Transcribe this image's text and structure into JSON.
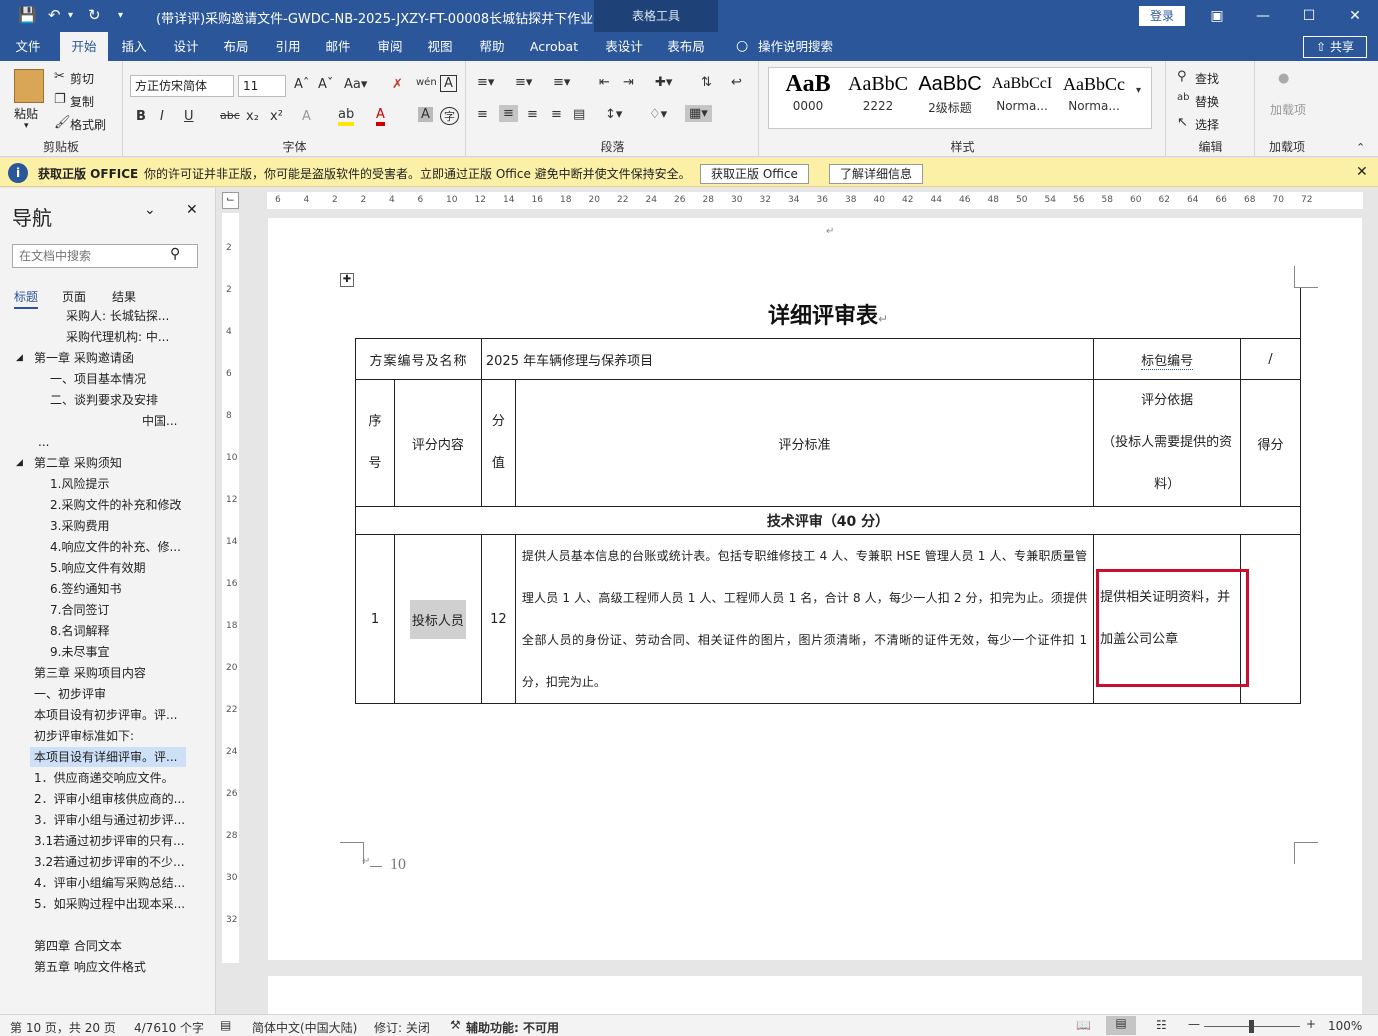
{
  "titlebar": {
    "title": "(带详评)采购邀请文件-GWDC-NB-2025-JXZY-FT-00008长城钻探井下作业...",
    "table_tools": "表格工具",
    "login": "登录"
  },
  "menu": {
    "tabs": [
      "文件",
      "开始",
      "插入",
      "设计",
      "布局",
      "引用",
      "邮件",
      "审阅",
      "视图",
      "帮助",
      "Acrobat",
      "表设计",
      "表布局"
    ],
    "search": "操作说明搜索",
    "share": "共享"
  },
  "ribbon": {
    "clipboard": {
      "label": "剪贴板",
      "paste": "粘贴",
      "cut": "剪切",
      "copy": "复制",
      "format_painter": "格式刷"
    },
    "font": {
      "label": "字体",
      "font_name": "方正仿宋简体",
      "font_size": "11"
    },
    "paragraph": {
      "label": "段落"
    },
    "styles": {
      "label": "样式",
      "items": [
        {
          "preview": "AaB",
          "name": "0000"
        },
        {
          "preview": "AaBbC",
          "name": "2222"
        },
        {
          "preview": "AaBbC",
          "name": "2级标题"
        },
        {
          "preview": "AaBbCcI",
          "name": "Norma..."
        },
        {
          "preview": "AaBbCc",
          "name": "Norma..."
        }
      ]
    },
    "editing": {
      "label": "编辑",
      "find": "查找",
      "replace": "替换",
      "select": "选择"
    },
    "addins": {
      "label": "加载项",
      "load": "加载项"
    }
  },
  "license": {
    "title": "获取正版 OFFICE",
    "message": "你的许可证并非正版，你可能是盗版软件的受害者。立即通过正版 Office 避免中断并使文件保持安全。",
    "btn_get": "获取正版 Office",
    "btn_learn": "了解详细信息"
  },
  "nav": {
    "title": "导航",
    "search_placeholder": "在文档中搜索",
    "tabs": [
      "标题",
      "页面",
      "结果"
    ],
    "items": [
      {
        "text": "采购人: 长城钻探...",
        "indent": 66,
        "selected": false,
        "arrow": ""
      },
      {
        "text": "采购代理机构: 中...",
        "indent": 66,
        "selected": false,
        "arrow": ""
      },
      {
        "text": "第一章 采购邀请函",
        "indent": 34,
        "selected": false,
        "arrow": "◢"
      },
      {
        "text": "一、项目基本情况",
        "indent": 50,
        "selected": false,
        "arrow": ""
      },
      {
        "text": "二、谈判要求及安排",
        "indent": 50,
        "selected": false,
        "arrow": ""
      },
      {
        "text": "中国...",
        "indent": 142,
        "selected": false,
        "arrow": ""
      },
      {
        "text": "...",
        "indent": 38,
        "selected": false,
        "arrow": ""
      },
      {
        "text": "第二章 采购须知",
        "indent": 34,
        "selected": false,
        "arrow": "◢"
      },
      {
        "text": "1.风险提示",
        "indent": 50,
        "selected": false,
        "arrow": ""
      },
      {
        "text": "2.采购文件的补充和修改",
        "indent": 50,
        "selected": false,
        "arrow": ""
      },
      {
        "text": "3.采购费用",
        "indent": 50,
        "selected": false,
        "arrow": ""
      },
      {
        "text": "4.响应文件的补充、修...",
        "indent": 50,
        "selected": false,
        "arrow": ""
      },
      {
        "text": "5.响应文件有效期",
        "indent": 50,
        "selected": false,
        "arrow": ""
      },
      {
        "text": "6.签约通知书",
        "indent": 50,
        "selected": false,
        "arrow": ""
      },
      {
        "text": "7.合同签订",
        "indent": 50,
        "selected": false,
        "arrow": ""
      },
      {
        "text": "8.名词解释",
        "indent": 50,
        "selected": false,
        "arrow": ""
      },
      {
        "text": "9.未尽事宜",
        "indent": 50,
        "selected": false,
        "arrow": ""
      },
      {
        "text": "第三章 采购项目内容",
        "indent": 34,
        "selected": false,
        "arrow": ""
      },
      {
        "text": "一、初步评审",
        "indent": 34,
        "selected": false,
        "arrow": ""
      },
      {
        "text": "本项目设有初步评审。评...",
        "indent": 34,
        "selected": false,
        "arrow": ""
      },
      {
        "text": "初步评审标准如下:",
        "indent": 34,
        "selected": false,
        "arrow": ""
      },
      {
        "text": "本项目设有详细评审。评...",
        "indent": 34,
        "selected": true,
        "arrow": ""
      },
      {
        "text": "1．供应商递交响应文件。",
        "indent": 34,
        "selected": false,
        "arrow": ""
      },
      {
        "text": "2．评审小组审核供应商的...",
        "indent": 34,
        "selected": false,
        "arrow": ""
      },
      {
        "text": "3．评审小组与通过初步评...",
        "indent": 34,
        "selected": false,
        "arrow": ""
      },
      {
        "text": "3.1若通过初步评审的只有...",
        "indent": 34,
        "selected": false,
        "arrow": ""
      },
      {
        "text": "3.2若通过初步评审的不少...",
        "indent": 34,
        "selected": false,
        "arrow": ""
      },
      {
        "text": "4．评审小组编写采购总结...",
        "indent": 34,
        "selected": false,
        "arrow": ""
      },
      {
        "text": "5．如采购过程中出现本采...",
        "indent": 34,
        "selected": false,
        "arrow": ""
      },
      {
        "text": "",
        "indent": 34,
        "selected": false,
        "arrow": ""
      },
      {
        "text": "第四章 合同文本",
        "indent": 34,
        "selected": false,
        "arrow": ""
      },
      {
        "text": "第五章 响应文件格式",
        "indent": 34,
        "selected": false,
        "arrow": ""
      }
    ]
  },
  "ruler": {
    "h": [
      "6",
      "4",
      "2",
      "2",
      "4",
      "6",
      "10",
      "12",
      "14",
      "16",
      "18",
      "20",
      "22",
      "24",
      "26",
      "28",
      "30",
      "32",
      "34",
      "36",
      "38",
      "40",
      "42",
      "44",
      "46",
      "48",
      "50",
      "54",
      "56",
      "58",
      "60",
      "62",
      "64",
      "66",
      "68",
      "70",
      "72"
    ],
    "v": [
      "2",
      "2",
      "4",
      "6",
      "8",
      "10",
      "12",
      "14",
      "16",
      "18",
      "20",
      "22",
      "24",
      "26",
      "28",
      "30",
      "32"
    ]
  },
  "document": {
    "table_title": "详细评审表",
    "plan_label": "方案编号及名称",
    "plan_value": "2025 年车辆修理与保养项目",
    "package_label": "标包编号",
    "package_value": "/",
    "head_seq": "序号",
    "head_content": "评分内容",
    "head_points": "分值",
    "head_standard": "评分标准",
    "head_basis": "评分依据",
    "head_basis_sub": "（投标人需要提供的资料）",
    "head_score": "得分",
    "section": "技术评审（40 分）",
    "row1": {
      "seq": "1",
      "content": "投标人员",
      "points": "12",
      "standard": "提供人员基本信息的台账或统计表。包括专职维修技工 4 人、专兼职 HSE 管理人员 1 人、专兼职质量管理人员 1 人、高级工程师人员 1 人、工程师人员 1 名，合计 8 人，每少一人扣 2 分，扣完为止。须提供全部人员的身份证、劳动合同、相关证件的图片，图片须清晰，不清晰的证件无效，每少一个证件扣 1 分，扣完为止。",
      "basis": "提供相关证明资料，并加盖公司公章",
      "score": ""
    },
    "page_number": "10",
    "para_mark": "↵"
  },
  "status": {
    "page": "第 10 页，共 20 页",
    "words": "4/7610 个字",
    "language": "简体中文(中国大陆)",
    "track": "修订: 关闭",
    "accessibility": "辅助功能: 不可用",
    "zoom": "100%"
  }
}
